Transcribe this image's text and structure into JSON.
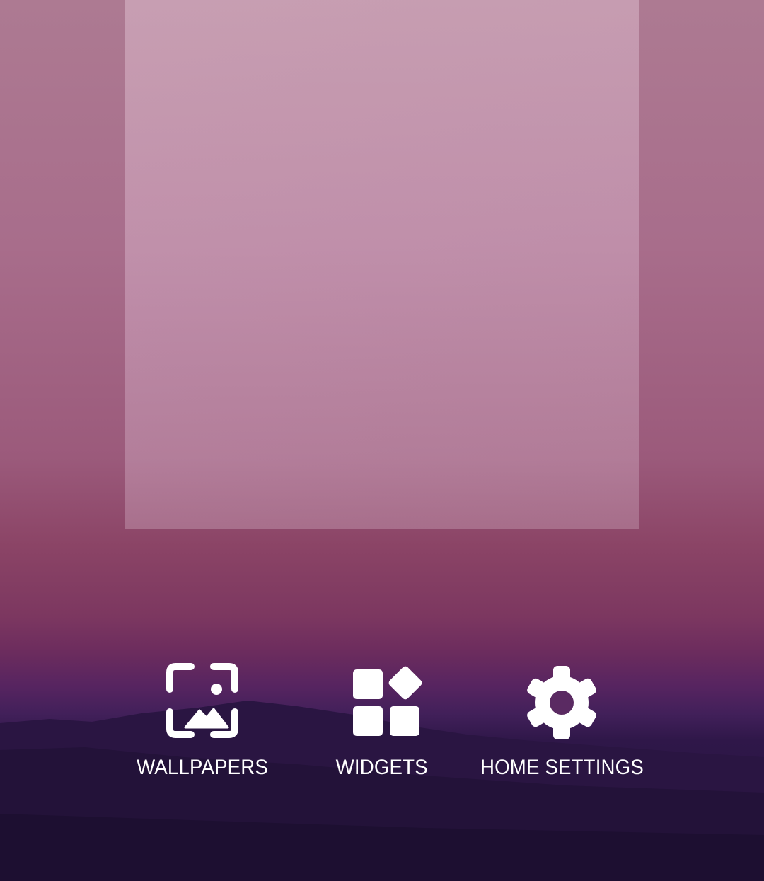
{
  "home_edit": {
    "options": [
      {
        "label": "WALLPAPERS",
        "icon": "wallpapers-icon"
      },
      {
        "label": "WIDGETS",
        "icon": "widgets-icon"
      },
      {
        "label": "HOME SETTINGS",
        "icon": "gear-icon"
      }
    ]
  },
  "colors": {
    "sky_top": "#ad7a92",
    "horizon": "#6c2c5e",
    "hills": "#241340",
    "label": "#ffffff"
  }
}
